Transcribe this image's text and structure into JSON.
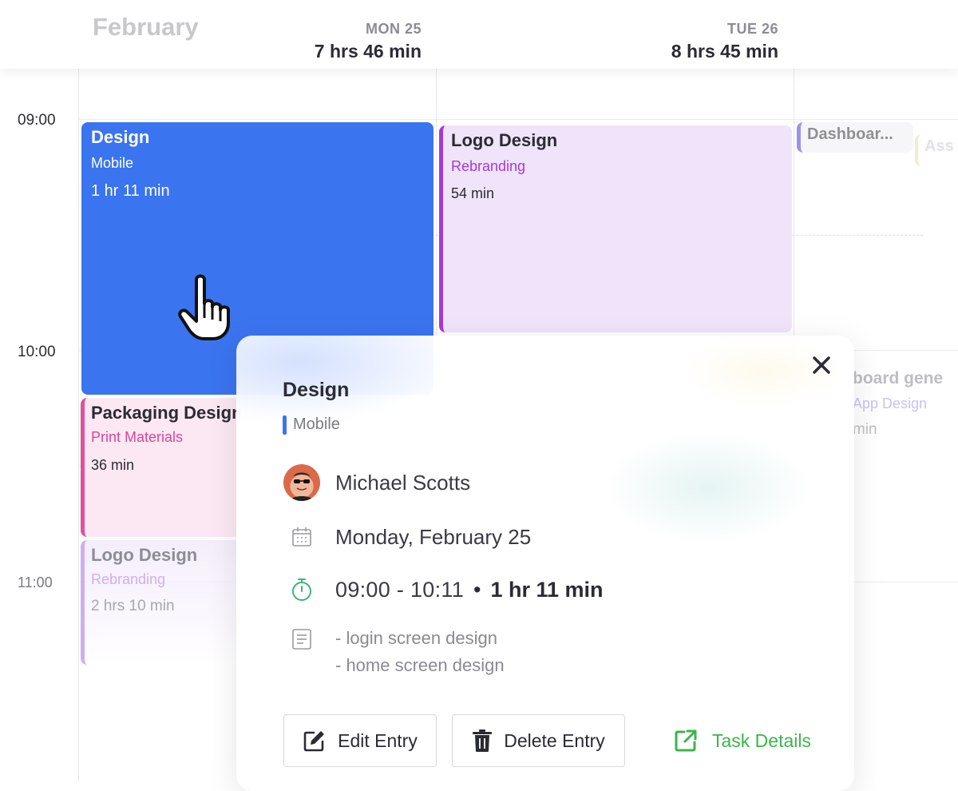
{
  "header": {
    "month": "February",
    "days": [
      {
        "name": "MON 25",
        "total": "7 hrs 46 min"
      },
      {
        "name": "TUE 26",
        "total": "8 hrs 45 min"
      }
    ]
  },
  "times": [
    "09:00",
    "10:00",
    "11:00"
  ],
  "events": {
    "design": {
      "title": "Design",
      "project": "Mobile",
      "duration": "1 hr 11 min",
      "color": "#3a74ef"
    },
    "logo_design_1": {
      "title": "Logo Design",
      "project": "Rebranding",
      "duration": "54 min",
      "color": "#a43ad8"
    },
    "dashboard": {
      "title": "Dashboar...",
      "color": "#7b6ee0"
    },
    "asset": {
      "title": "Ass",
      "color": "#f6dfa8"
    },
    "packaging": {
      "title": "Packaging Design",
      "project": "Print Materials",
      "duration": "36 min",
      "color": "#e0509d"
    },
    "logo_design_2": {
      "title": "Logo Design",
      "project": "Rebranding",
      "duration": "2 hrs 10 min",
      "color": "#c7a0ee"
    },
    "dashboard_gen": {
      "title": "board gene",
      "project": "App Design",
      "duration": "min"
    }
  },
  "popup": {
    "title": "Design",
    "project": "Mobile",
    "user": "Michael Scotts",
    "date": "Monday, February 25",
    "time_range": "09:00 - 10:11",
    "separator": "•",
    "total": "1 hr 11 min",
    "notes": [
      "- login screen design",
      "- home screen design"
    ],
    "buttons": {
      "edit": "Edit Entry",
      "delete": "Delete Entry",
      "task_details": "Task Details"
    },
    "accent_color": "#3cb54a"
  }
}
